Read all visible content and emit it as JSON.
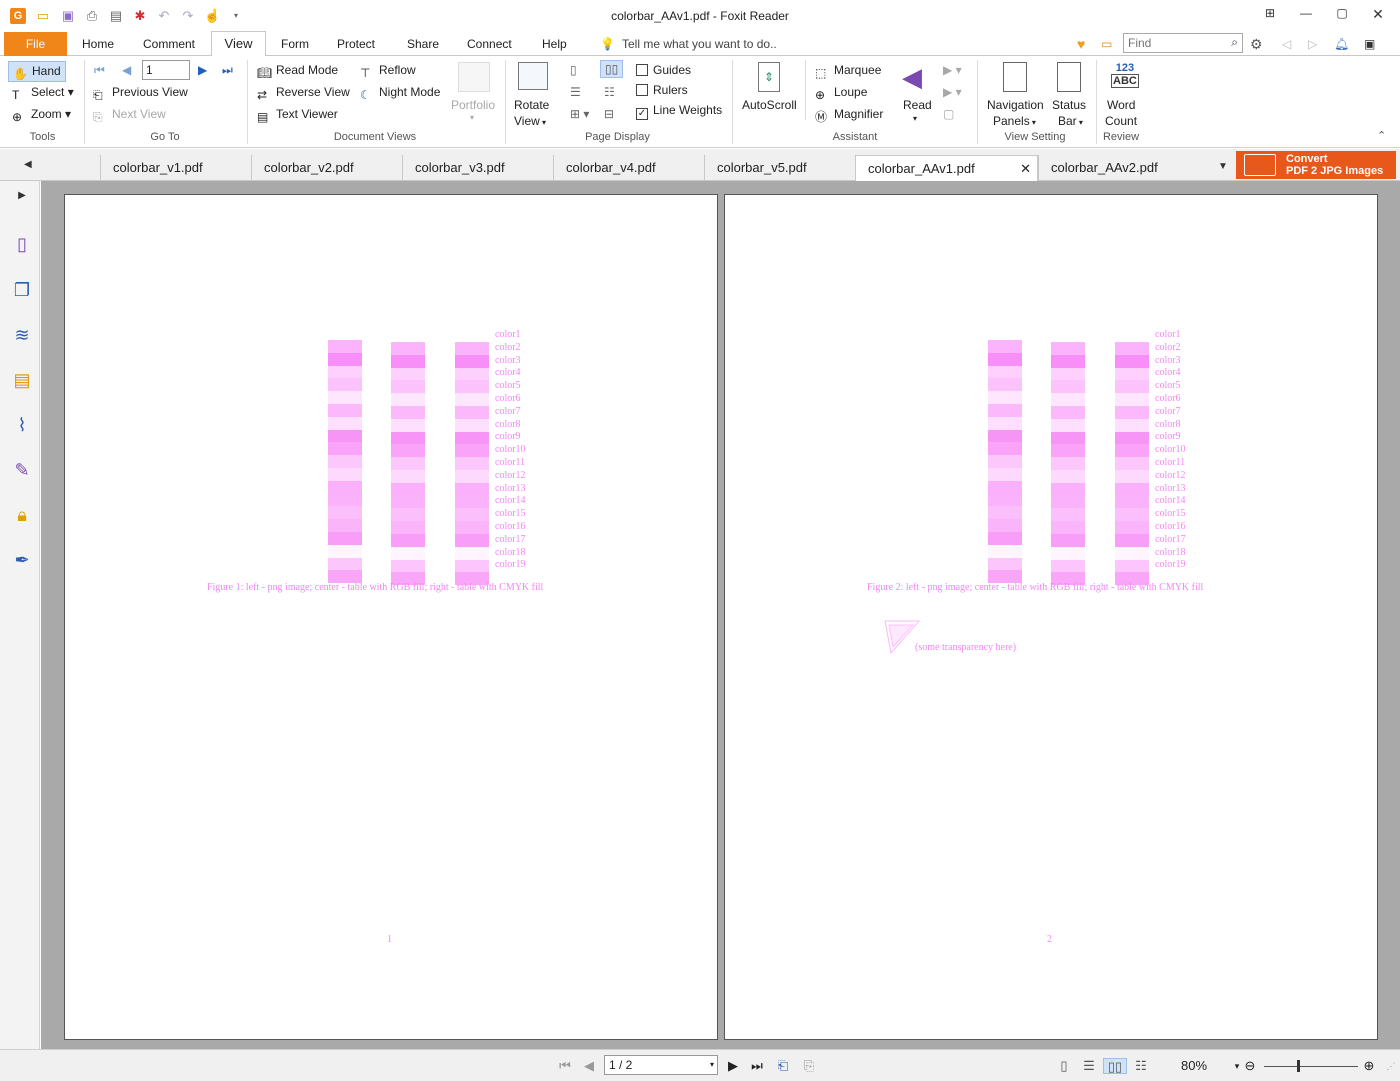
{
  "window": {
    "title": "colorbar_AAv1.pdf - Foxit Reader"
  },
  "menu": {
    "file": "File",
    "items": [
      "Home",
      "Comment",
      "View",
      "Form",
      "Protect",
      "Share",
      "Connect",
      "Help"
    ],
    "tell_me": "Tell me what you want to do..",
    "find_placeholder": "Find"
  },
  "ribbon": {
    "tools": {
      "hand": "Hand",
      "select": "Select",
      "zoom": "Zoom",
      "group": "Tools"
    },
    "goto": {
      "page_value": "1",
      "previous_view": "Previous View",
      "next_view": "Next View",
      "group": "Go To"
    },
    "document_views": {
      "read_mode": "Read Mode",
      "reverse_view": "Reverse View",
      "text_viewer": "Text Viewer",
      "reflow": "Reflow",
      "night_mode": "Night Mode",
      "portfolio": "Portfolio",
      "group": "Document Views"
    },
    "page_display": {
      "rotate_view": "Rotate",
      "rotate_view2": "View",
      "guides": "Guides",
      "rulers": "Rulers",
      "line_weights": "Line Weights",
      "group": "Page Display"
    },
    "assistant": {
      "autoscroll": "AutoScroll",
      "marquee": "Marquee",
      "loupe": "Loupe",
      "magnifier": "Magnifier",
      "read": "Read",
      "group": "Assistant"
    },
    "view_setting": {
      "nav_panels_1": "Navigation",
      "nav_panels_2": "Panels",
      "status_bar_1": "Status",
      "status_bar_2": "Bar",
      "group": "View Setting"
    },
    "review": {
      "word_count_1": "Word",
      "word_count_2": "Count",
      "icon_text_1": "123",
      "icon_text_2": "ABC",
      "group": "Review"
    }
  },
  "tabs": [
    "colorbar_v1.pdf",
    "colorbar_v2.pdf",
    "colorbar_v3.pdf",
    "colorbar_v4.pdf",
    "colorbar_v5.pdf",
    "colorbar_AAv1.pdf",
    "colorbar_AAv2.pdf"
  ],
  "convert": {
    "line1": "Convert",
    "line2": "PDF 2 JPG Images"
  },
  "pages": [
    {
      "caption": "Figure 1: left - png image; center - table with RGB fill; right - table with CMYK fill",
      "number": "1"
    },
    {
      "caption": "Figure 2: left - png image; center - table with RGB fill; right - table with CMYK fill",
      "number": "2",
      "note": "(some transparency here)"
    }
  ],
  "color_labels": [
    "color1",
    "color2",
    "color3",
    "color4",
    "color5",
    "color6",
    "color7",
    "color8",
    "color9",
    "color10",
    "color11",
    "color12",
    "color13",
    "color14",
    "color15",
    "color16",
    "color17",
    "color18",
    "color19"
  ],
  "bar_colors": [
    "#fbb3fb",
    "#f88ef8",
    "#fdd0fd",
    "#fcc2fc",
    "#fee6fe",
    "#fbb8fb",
    "#fee0fe",
    "#f795f7",
    "#f9a3f9",
    "#fcc8fc",
    "#fdd9fd",
    "#fab0fa",
    "#fab3fa",
    "#fbc0fb",
    "#fab5fa",
    "#f89ef8",
    "#fff5ff",
    "#fcc5fc",
    "#f9a6f9"
  ],
  "status": {
    "page_display": "1 / 2",
    "zoom": "80%"
  }
}
